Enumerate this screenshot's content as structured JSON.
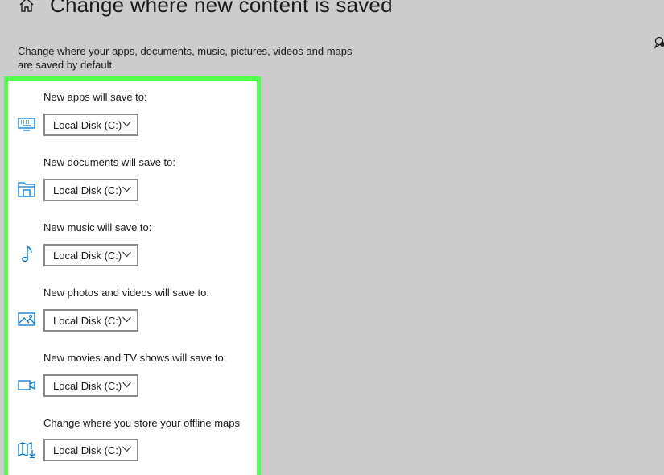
{
  "header": {
    "title": "Change where new content is saved",
    "home_icon": "home-icon",
    "feedback_icon": "feedback-icon"
  },
  "description": "Change where your apps, documents, music, pictures, videos and maps are saved by default.",
  "colors": {
    "highlight_border": "#53ff4d",
    "icon_blue": "#0078d7",
    "background": "#cccccc"
  },
  "settings": [
    {
      "label": "New apps will save to:",
      "icon": "keyboard-icon",
      "value": "Local Disk (C:)"
    },
    {
      "label": "New documents will save to:",
      "icon": "folder-icon",
      "value": "Local Disk (C:)"
    },
    {
      "label": "New music will save to:",
      "icon": "music-note-icon",
      "value": "Local Disk (C:)"
    },
    {
      "label": "New photos and videos will save to:",
      "icon": "photo-icon",
      "value": "Local Disk (C:)"
    },
    {
      "label": "New movies and TV shows will save to:",
      "icon": "video-camera-icon",
      "value": "Local Disk (C:)"
    },
    {
      "label": "Change where you store your offline maps",
      "icon": "map-icon",
      "value": "Local Disk (C:)"
    }
  ]
}
